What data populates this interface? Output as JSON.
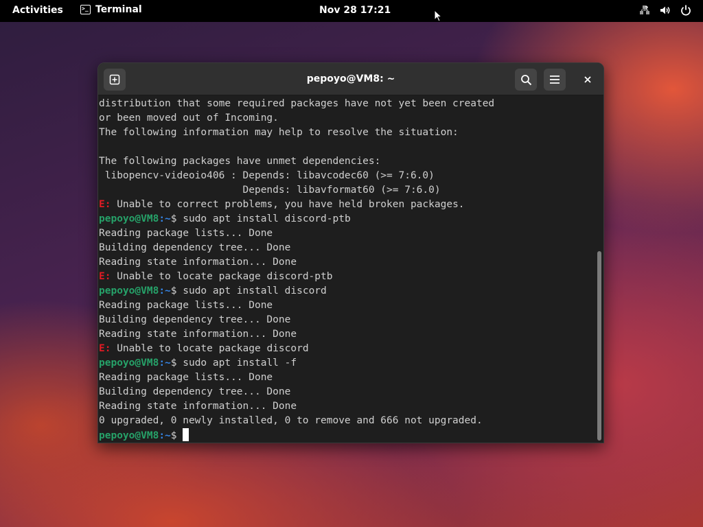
{
  "topbar": {
    "activities": "Activities",
    "app_name": "Terminal",
    "clock": "Nov 28  17:21",
    "tray_icons": [
      "network-unknown-icon",
      "volume-icon",
      "power-icon"
    ]
  },
  "window": {
    "title": "pepoyo@VM8: ~",
    "buttons": [
      "new-tab-icon",
      "search-icon",
      "hamburger-menu-icon",
      "close-icon"
    ]
  },
  "terminal": {
    "lines": [
      {
        "text": "distribution that some required packages have not yet been created"
      },
      {
        "text": "or been moved out of Incoming."
      },
      {
        "text": "The following information may help to resolve the situation:"
      },
      {
        "text": ""
      },
      {
        "text": "The following packages have unmet dependencies:"
      },
      {
        "text": " libopencv-videoio406 : Depends: libavcodec60 (>= 7:6.0)"
      },
      {
        "text": "                        Depends: libavformat60 (>= 7:6.0)"
      },
      {
        "err": "E:",
        "text": " Unable to correct problems, you have held broken packages."
      },
      {
        "user": "pepoyo@VM8",
        "path": ":~",
        "text": "$ sudo apt install discord-ptb"
      },
      {
        "text": "Reading package lists... Done"
      },
      {
        "text": "Building dependency tree... Done"
      },
      {
        "text": "Reading state information... Done"
      },
      {
        "err": "E:",
        "text": " Unable to locate package discord-ptb"
      },
      {
        "user": "pepoyo@VM8",
        "path": ":~",
        "text": "$ sudo apt install discord"
      },
      {
        "text": "Reading package lists... Done"
      },
      {
        "text": "Building dependency tree... Done"
      },
      {
        "text": "Reading state information... Done"
      },
      {
        "err": "E:",
        "text": " Unable to locate package discord"
      },
      {
        "user": "pepoyo@VM8",
        "path": ":~",
        "text": "$ sudo apt install -f"
      },
      {
        "text": "Reading package lists... Done"
      },
      {
        "text": "Building dependency tree... Done"
      },
      {
        "text": "Reading state information... Done"
      },
      {
        "text": "0 upgraded, 0 newly installed, 0 to remove and 666 not upgraded."
      },
      {
        "user": "pepoyo@VM8",
        "path": ":~",
        "text": "$ ",
        "cursor": true
      }
    ]
  },
  "colors": {
    "error": "#e01b24",
    "prompt_user": "#26a269",
    "prompt_path": "#3584e4",
    "terminal_bg": "#1e1e1e",
    "headerbar_bg": "#303030"
  }
}
